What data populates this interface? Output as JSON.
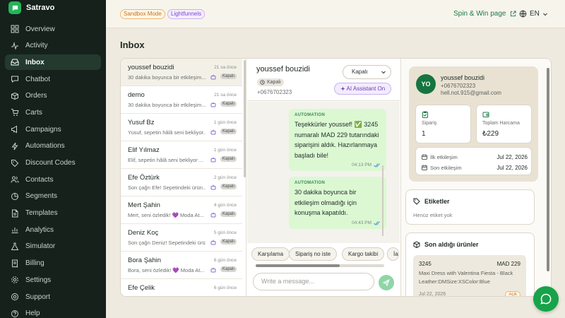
{
  "brand": {
    "name": "Satravo"
  },
  "sidebar": {
    "items": [
      {
        "label": "Overview",
        "icon": "grid-icon",
        "active": false
      },
      {
        "label": "Activity",
        "icon": "activity-icon",
        "active": false
      },
      {
        "label": "Inbox",
        "icon": "inbox-icon",
        "active": true
      },
      {
        "label": "Chatbot",
        "icon": "chat-icon",
        "active": false
      },
      {
        "label": "Orders",
        "icon": "box-icon",
        "active": false
      },
      {
        "label": "Carts",
        "icon": "cart-icon",
        "active": false
      },
      {
        "label": "Campaigns",
        "icon": "megaphone-icon",
        "active": false
      },
      {
        "label": "Automations",
        "icon": "bolt-icon",
        "active": false
      },
      {
        "label": "Discount Codes",
        "icon": "tag-icon",
        "active": false
      },
      {
        "label": "Contacts",
        "icon": "users-icon",
        "active": false
      },
      {
        "label": "Segments",
        "icon": "pie-icon",
        "active": false
      },
      {
        "label": "Templates",
        "icon": "file-icon",
        "active": false
      },
      {
        "label": "Analytics",
        "icon": "chart-icon",
        "active": false
      },
      {
        "label": "Simulator",
        "icon": "flask-icon",
        "active": false
      },
      {
        "label": "Billing",
        "icon": "receipt-icon",
        "active": false
      },
      {
        "label": "Settings",
        "icon": "gear-icon",
        "active": false
      },
      {
        "label": "Support",
        "icon": "help-icon",
        "active": false
      },
      {
        "label": "Help",
        "icon": "question-icon",
        "active": false
      }
    ]
  },
  "topbar": {
    "sandbox_badge": "Sandbox Mode",
    "lightfunnels_badge": "Lightfunnels",
    "spin_link": "Spin & Win page",
    "language": "EN"
  },
  "page": {
    "title": "Inbox"
  },
  "conversations": [
    {
      "name": "youssef bouzidi",
      "time": "21 sa önce",
      "preview": "30 dakika boyunca bir etkileşim...",
      "status": "Kapalı",
      "active": true
    },
    {
      "name": "demo",
      "time": "21 sa önce",
      "preview": "30 dakika boyunca bir etkileşim...",
      "status": "Kapalı",
      "active": false
    },
    {
      "name": "Yusuf Bz",
      "time": "1 gün önce",
      "preview": "Yusuf, sepetin hâlâ seni bekliyor...",
      "status": "Kapalı",
      "active": false
    },
    {
      "name": "Elif Yılmaz",
      "time": "1 gün önce",
      "preview": "Elif, sepetin hâlâ seni bekliyor ...",
      "status": "Kapalı",
      "active": false
    },
    {
      "name": "Efe Öztürk",
      "time": "2 gün önce",
      "preview": "Son çağrı Efe! Sepetindeki ürün...",
      "status": "Kapalı",
      "active": false
    },
    {
      "name": "Mert Şahin",
      "time": "4 gün önce",
      "preview": "Mert, seni özledik! 💜 Moda At...",
      "status": "Kapalı",
      "active": false
    },
    {
      "name": "Deniz Koç",
      "time": "5 gün önce",
      "preview": "Son çağrı Deniz! Sepetindeki ürü...",
      "status": "Kapalı",
      "active": false
    },
    {
      "name": "Bora Şahin",
      "time": "6 gün önce",
      "preview": "Bora, seni özledik! 💜 Moda At...",
      "status": "Kapalı",
      "active": false
    },
    {
      "name": "Efe Çelik",
      "time": "6 gün önce",
      "preview": "",
      "status": "",
      "active": false
    }
  ],
  "chat": {
    "contact_name": "youssef bouzidi",
    "status_badge": "Kapalı",
    "phone": "+0676702323",
    "status_select": "Kapalı",
    "ai_button": "AI Assistant On",
    "messages": [
      {
        "tag": "AUTOMATION",
        "text": "Teşekkürler youssef! ✅ 3245 numaralı MAD 229 tutarındaki siparişini aldık. Hazırlanmaya başladı bile!",
        "time": "04:13 PM"
      },
      {
        "tag": "AUTOMATION",
        "text": "30 dakika boyunca bir etkileşim olmadığı için konuşma kapatıldı.",
        "time": "04:43 PM"
      }
    ],
    "quick_replies": [
      "Karşılama",
      "Sipariş no iste",
      "Kargo takibi",
      "İa"
    ],
    "compose_placeholder": "Write a message..."
  },
  "contact": {
    "initials": "YO",
    "name": "youssef bouzidi",
    "phone": "+0676702323",
    "email": "hell.not.915@gmail.com",
    "orders_label": "Sipariş",
    "orders_value": "1",
    "spend_label": "Toplam Harcama",
    "spend_value": "₺229",
    "first_interaction_label": "İlk etkileşim",
    "first_interaction_value": "Jul 22, 2026",
    "last_interaction_label": "Son etkileşim",
    "last_interaction_value": "Jul 22, 2026"
  },
  "tags_card": {
    "title": "Etiketler",
    "empty": "Henüz etiket yok"
  },
  "products_card": {
    "title": "Son aldığı ürünler",
    "order_id": "3245",
    "price": "MAD 229",
    "description": "Maxi Dress with Valentina Fiesta - Black Leather:DMSize:XSColor:Blue",
    "date": "Jul 22, 2026",
    "status": "Açık"
  },
  "colors": {
    "accent": "#17a34a",
    "sidebar_bg": "#16211c",
    "bubble_bg": "#dcf8d3"
  }
}
